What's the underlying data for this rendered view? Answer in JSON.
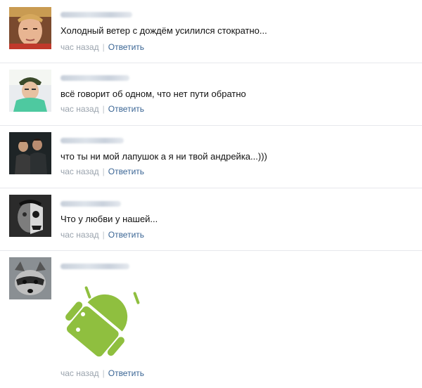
{
  "comments": [
    {
      "text": "Холодный ветер с дождём усилился стократно...",
      "time": "час назад",
      "reply": "Ответить"
    },
    {
      "text": "всё говорит об одном, что нет пути обратно",
      "time": "час назад",
      "reply": "Ответить"
    },
    {
      "text": "что ты ни мой лапушок а я ни твой андрейка...)))",
      "time": "час назад",
      "reply": "Ответить"
    },
    {
      "text": "Что у любви у нашей...",
      "time": "час назад",
      "reply": "Ответить"
    },
    {
      "text": "",
      "time": "час назад",
      "reply": "Ответить",
      "attachment": "android-sticker"
    }
  ],
  "separator": "|",
  "colors": {
    "link": "#3a6594",
    "muted": "#9aa3ad",
    "divider": "#e7e8ec",
    "android_green": "#8fbf3f"
  },
  "icons": [
    "android-sticker"
  ]
}
